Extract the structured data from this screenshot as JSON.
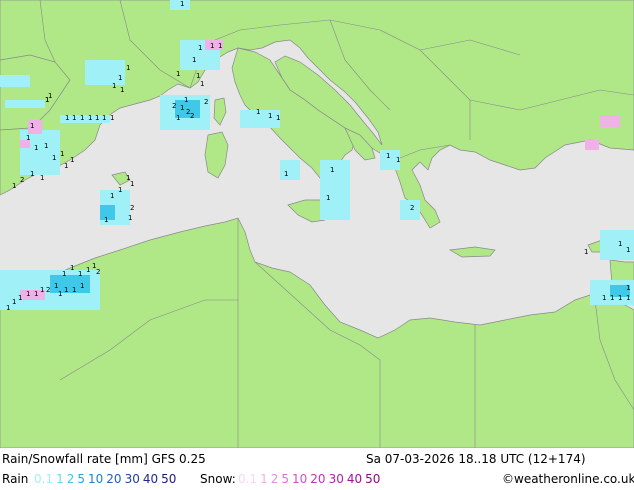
{
  "header": {
    "title": "Rain/Snowfall rate [mm] GFS 0.25",
    "datetime": "Sa 07-03-2026 18..18 UTC (12+174)"
  },
  "legend": {
    "rain_label": "Rain",
    "rain_values": [
      "0.1",
      "1",
      "2",
      "5",
      "10",
      "20",
      "30",
      "40",
      "50"
    ],
    "rain_colors": [
      "#a0f0f8",
      "#60e0f0",
      "#40c8e8",
      "#20a8e0",
      "#2080d0",
      "#2060c0",
      "#2040a8",
      "#202890",
      "#201880"
    ],
    "snow_label": "Snow:",
    "snow_values": [
      "0.1",
      "1",
      "2",
      "5",
      "10",
      "20",
      "30",
      "40",
      "50"
    ],
    "snow_colors": [
      "#f8d8f0",
      "#f0b0e8",
      "#e890e0",
      "#e070d8",
      "#d050c8",
      "#c030b8",
      "#b020a8",
      "#a01098",
      "#900888"
    ],
    "credit": "©weatheronline.co.uk"
  },
  "map": {
    "land_color": "#b0e888",
    "sea_color": "#e6e6e6",
    "border_color": "#888888",
    "precip_labels": [
      "1",
      "1",
      "1",
      "1",
      "1",
      "1",
      "1",
      "1",
      "1",
      "1",
      "1",
      "1",
      "1",
      "1",
      "1",
      "1",
      "1",
      "1",
      "2",
      "1",
      "1",
      "2",
      "2",
      "1",
      "2",
      "1",
      "1",
      "1",
      "1",
      "1",
      "1",
      "1",
      "1",
      "1",
      "1",
      "1",
      "2",
      "1",
      "1",
      "1",
      "1",
      "1",
      "1",
      "2",
      "1",
      "1",
      "1",
      "1",
      "1",
      "1",
      "1",
      "1",
      "2",
      "1",
      "1",
      "1",
      "1",
      "1",
      "1",
      "2",
      "1",
      "1",
      "1",
      "1",
      "1",
      "1",
      "1",
      "1",
      "1",
      "1",
      "2",
      "1",
      "1",
      "1",
      "1",
      "1",
      "1",
      "1",
      "1",
      "1",
      "1",
      "1",
      "1"
    ]
  }
}
